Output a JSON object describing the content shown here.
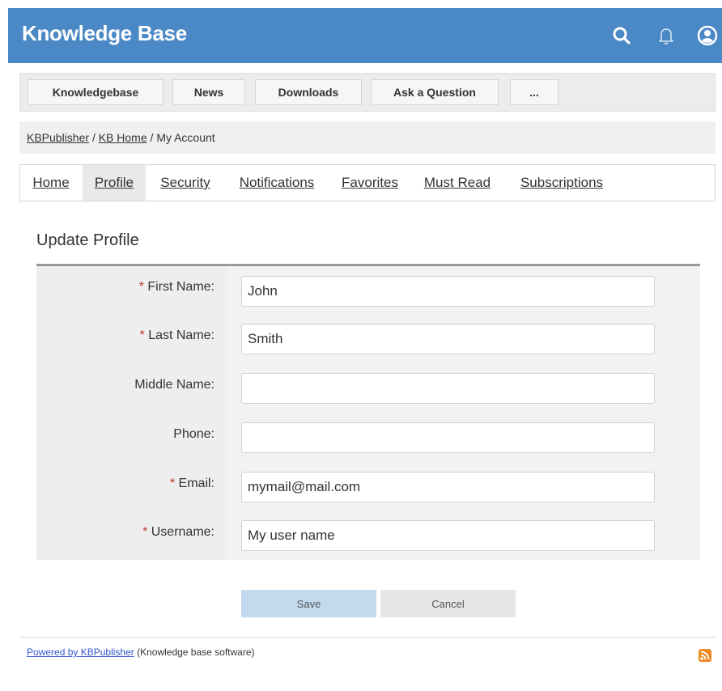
{
  "header": {
    "title": "Knowledge Base",
    "icons": [
      "search-icon",
      "bell-icon",
      "user-icon"
    ]
  },
  "topmenu": {
    "items": [
      "Knowledgebase",
      "News",
      "Downloads",
      "Ask a Question",
      "..."
    ]
  },
  "breadcrumb": {
    "items": [
      "KBPublisher",
      "KB Home",
      "My Account"
    ],
    "separator": "/"
  },
  "tabs": {
    "items": [
      "Home",
      "Profile",
      "Security",
      "Notifications",
      "Favorites",
      "Must Read",
      "Subscriptions"
    ],
    "active": "Profile"
  },
  "form": {
    "title": "Update Profile",
    "required_mark": "*",
    "fields": [
      {
        "label": "First Name:",
        "value": "John",
        "required": true
      },
      {
        "label": "Last Name:",
        "value": "Smith",
        "required": true
      },
      {
        "label": "Middle Name:",
        "value": "",
        "required": false
      },
      {
        "label": "Phone:",
        "value": "",
        "required": false
      },
      {
        "label": "Email:",
        "value": "mymail@mail.com",
        "required": true
      },
      {
        "label": "Username:",
        "value": "My user name",
        "required": true
      }
    ],
    "save_label": "Save",
    "cancel_label": "Cancel"
  },
  "footer": {
    "link_text": "Powered by KBPublisher",
    "suffix": "(Knowledge base software)",
    "rss_icon": "rss-icon"
  },
  "colors": {
    "header_bg": "#4a88c6",
    "required": "#c0392b",
    "save_button": "#c3d9ee"
  }
}
